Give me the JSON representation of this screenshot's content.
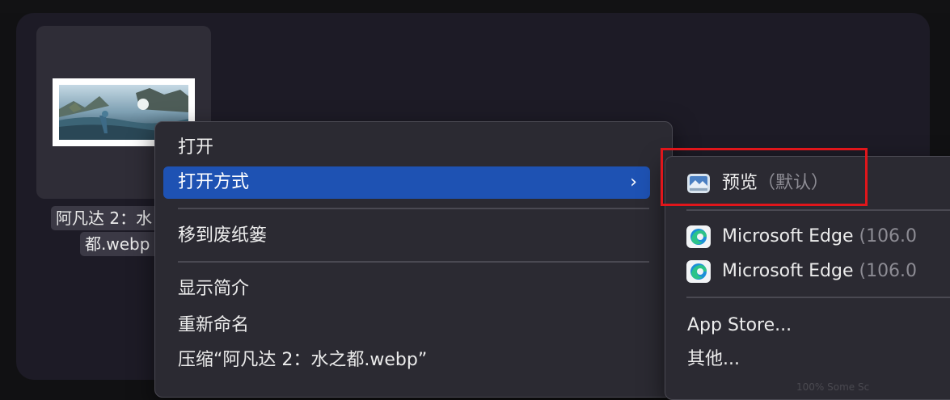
{
  "file": {
    "name_line1": "阿凡达 2：水",
    "name_line2": "都.webp"
  },
  "context_menu": {
    "items": [
      {
        "label": "打开"
      },
      {
        "label": "打开方式",
        "chevron": "›"
      },
      {
        "label": "移到废纸篓"
      },
      {
        "label": "显示简介"
      },
      {
        "label": "重新命名"
      },
      {
        "label": "压缩“阿凡达 2：水之都.webp”"
      }
    ]
  },
  "open_with_submenu": {
    "items": [
      {
        "label": "预览",
        "note": "（默认）",
        "icon": "preview-app-icon"
      },
      {
        "label": "Microsoft Edge",
        "note": "(106.0",
        "icon": "edge-icon"
      },
      {
        "label": "Microsoft Edge",
        "note": "(106.0",
        "icon": "edge-icon"
      },
      {
        "label": "App Store..."
      },
      {
        "label": "其他..."
      }
    ]
  },
  "status_faint": "100% Some Sc",
  "colors": {
    "highlight": "#1e52b3",
    "annotation_box": "#e0161b",
    "menu_bg": "#2b2a32"
  }
}
